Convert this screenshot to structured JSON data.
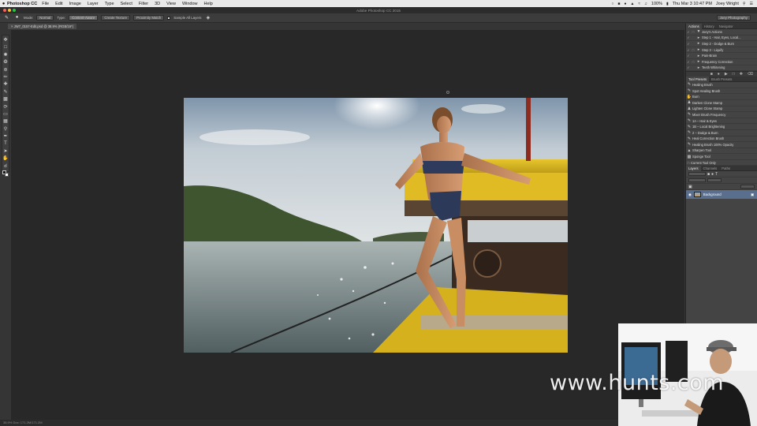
{
  "menubar": {
    "apple": "",
    "app": "Photoshop CC",
    "items": [
      "File",
      "Edit",
      "Image",
      "Layer",
      "Type",
      "Select",
      "Filter",
      "3D",
      "View",
      "Window",
      "Help"
    ],
    "battery": "100%",
    "clock": "Thu Mar 3  10:47 PM",
    "user": "Joey Wright"
  },
  "titlebar": {
    "title": "Adobe Photoshop CC 2015"
  },
  "options": {
    "mode_label": "Mode:",
    "mode_value": "Normal",
    "type_label": "Type:",
    "btn_content_aware": "Content-Aware",
    "btn_create_texture": "Create Texture",
    "btn_proximity": "Proximity Match",
    "sample_all_layers": "Sample All Layers",
    "workspace": "Joey Photography"
  },
  "document": {
    "tab": "× JW7_0157-Edit.psd @ 38.9% (RGB/16*)"
  },
  "panels": {
    "top_tabs": [
      "Actions",
      "History",
      "Navigator"
    ],
    "actions": [
      "Joey's Actions",
      "Step 1 - Hair, Eyes, Local...",
      "Step 2 - Dodge & Burn",
      "Step 3 - Liquify",
      "Pain-Brain",
      "Frequency Correction",
      "Teeth Whitening"
    ],
    "presets_tabs": [
      "Tool Presets",
      "Brush Presets"
    ],
    "presets": [
      "Healing Brush",
      "Spot Healing Brush",
      "Burn",
      "Darken Clone Stamp",
      "Lighten Clone Stamp",
      "Mixer Brush Frequency",
      "1A – Hair & Eyes",
      "1B – Local Brightening",
      "2 – Dodge & Burn",
      "Heal Correction Brush",
      "Healing Brush 100% Opacity",
      "Sharpen Tool",
      "Sponge Tool"
    ],
    "presets_footer": "Current Tool Only",
    "layers_tabs": [
      "Layers",
      "Channels",
      "Paths"
    ],
    "layer_name": "Background"
  },
  "status": {
    "text": "38.9%     Doc: 171.2M/171.2M"
  },
  "watermark": "www.hunts.com",
  "colors": {
    "accent": "#5a6f8e",
    "panel": "#444444",
    "canvas": "#282828"
  }
}
